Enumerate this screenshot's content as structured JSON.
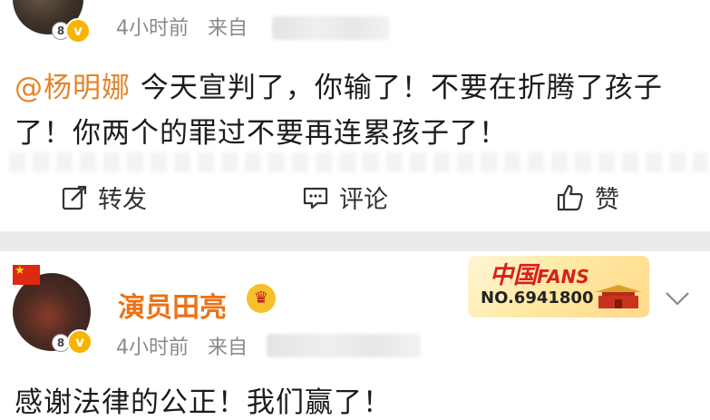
{
  "post1": {
    "time": "4小时前",
    "source_label": "来自",
    "mention": "@杨明娜",
    "content_line1_rest": " 今天宣判了，你输了！不要在折腾了孩子",
    "content_line2": "了！你两个的罪过不要再连累孩子了！",
    "actions": {
      "repost": "转发",
      "comment": "评论",
      "like": "赞"
    }
  },
  "post2": {
    "username": "演员田亮",
    "fans_badge": {
      "title_cn": "中国",
      "title_en": "FANS",
      "number": "NO.6941800"
    },
    "time": "4小时前",
    "source_label": "来自",
    "content": "感谢法律的公正！我们赢了！"
  },
  "colors": {
    "mention": "#e0862c",
    "username": "#eb7316",
    "verified_badge": "#f7b500",
    "fans_red": "#d4221c"
  },
  "icons": [
    "v-verified-icon",
    "repost-icon",
    "comment-icon",
    "like-icon",
    "crown-icon",
    "flag-icon",
    "chevron-down-icon"
  ]
}
